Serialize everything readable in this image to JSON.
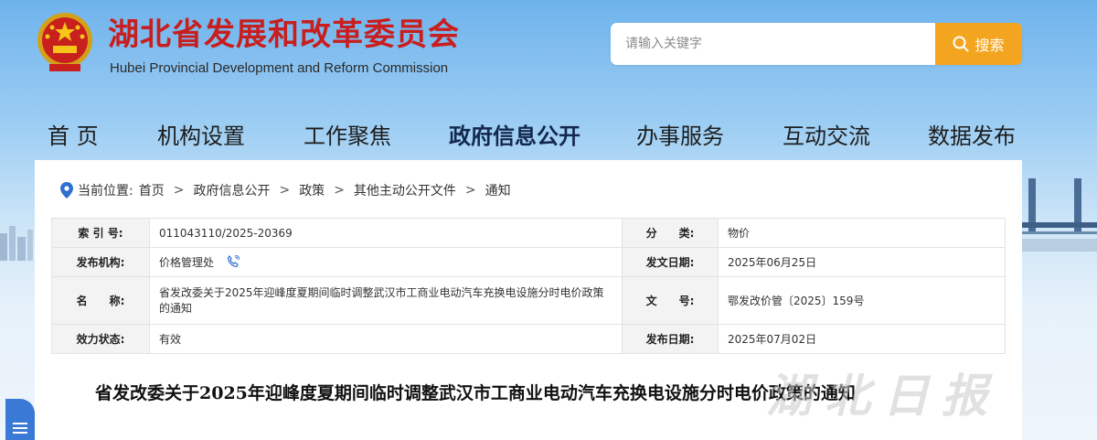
{
  "header": {
    "title": "湖北省发展和改革委员会",
    "subtitle": "Hubei Provincial Development and Reform Commission"
  },
  "search": {
    "placeholder": "请输入关键字",
    "button_label": "搜索"
  },
  "nav": {
    "items": [
      {
        "label": "首 页"
      },
      {
        "label": "机构设置"
      },
      {
        "label": "工作聚焦"
      },
      {
        "label": "政府信息公开",
        "active": true
      },
      {
        "label": "办事服务"
      },
      {
        "label": "互动交流"
      },
      {
        "label": "数据发布"
      }
    ]
  },
  "breadcrumb": {
    "prefix": "当前位置:",
    "items": [
      "首页",
      "政府信息公开",
      "政策",
      "其他主动公开文件",
      "通知"
    ],
    "separator": ">"
  },
  "meta": {
    "index_label": "索 引 号:",
    "index_value": "011043110/2025-20369",
    "category_label": "分　　类:",
    "category_value": "物价",
    "org_label": "发布机构:",
    "org_value": "价格管理处",
    "doc_date_label": "发文日期:",
    "doc_date_value": "2025年06月25日",
    "name_label": "名　　称:",
    "name_value": "省发改委关于2025年迎峰度夏期间临时调整武汉市工商业电动汽车充换电设施分时电价政策的通知",
    "doc_no_label": "文　　号:",
    "doc_no_value": "鄂发改价管〔2025〕159号",
    "status_label": "效力状态:",
    "status_value": "有效",
    "pub_date_label": "发布日期:",
    "pub_date_value": "2025年07月02日"
  },
  "document": {
    "title": "省发改委关于2025年迎峰度夏期间临时调整武汉市工商业电动汽车充换电设施分时电价政策的通知"
  },
  "watermark": "湖北日报",
  "colors": {
    "title_red": "#c81e1e",
    "search_orange": "#f3a51f",
    "side_tab_blue": "#3b79d6"
  }
}
